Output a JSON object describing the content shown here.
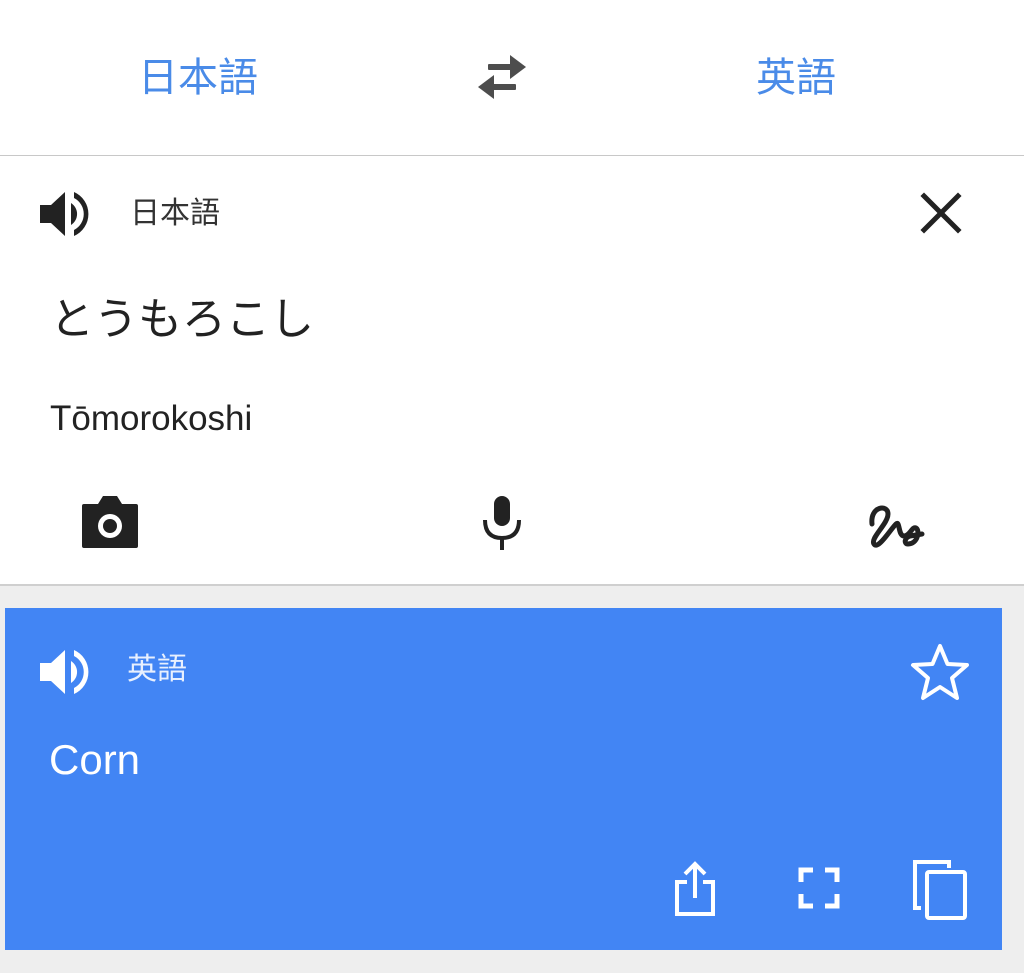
{
  "header": {
    "source_language": "日本語",
    "target_language": "英語",
    "swap_icon": "swap-icon"
  },
  "input": {
    "language_label": "日本語",
    "text": "とうもろこし",
    "transliteration": "Tōmorokoshi",
    "icons": [
      "speaker-icon",
      "close-icon",
      "camera-icon",
      "microphone-icon",
      "handwriting-icon"
    ]
  },
  "result": {
    "language_label": "英語",
    "text": "Corn",
    "background_color": "#4285f4",
    "icons": [
      "speaker-icon",
      "star-icon",
      "share-icon",
      "fullscreen-icon",
      "copy-icon"
    ]
  },
  "colors": {
    "accent": "#4a8be8",
    "result_background": "#4285f4"
  }
}
